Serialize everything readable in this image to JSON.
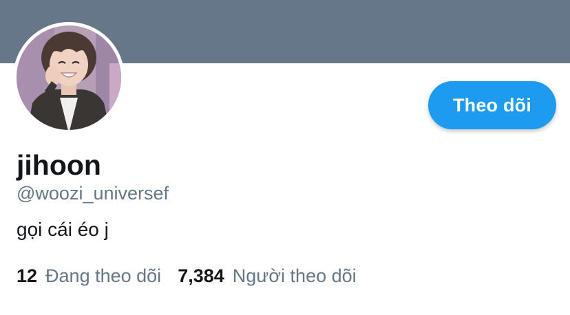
{
  "profile": {
    "display_name": "jihoon",
    "handle": "@woozi_universef",
    "bio": "gọi cái éo j",
    "banner_color": "#66778a"
  },
  "actions": {
    "follow_label": "Theo dõi",
    "follow_color": "#1d9bf0"
  },
  "stats": {
    "following_count": "12",
    "following_label": "Đang theo dõi",
    "followers_count": "7,384",
    "followers_label": "Người theo dõi"
  },
  "colors": {
    "primary_text": "#14171a",
    "secondary_text": "#657786"
  }
}
